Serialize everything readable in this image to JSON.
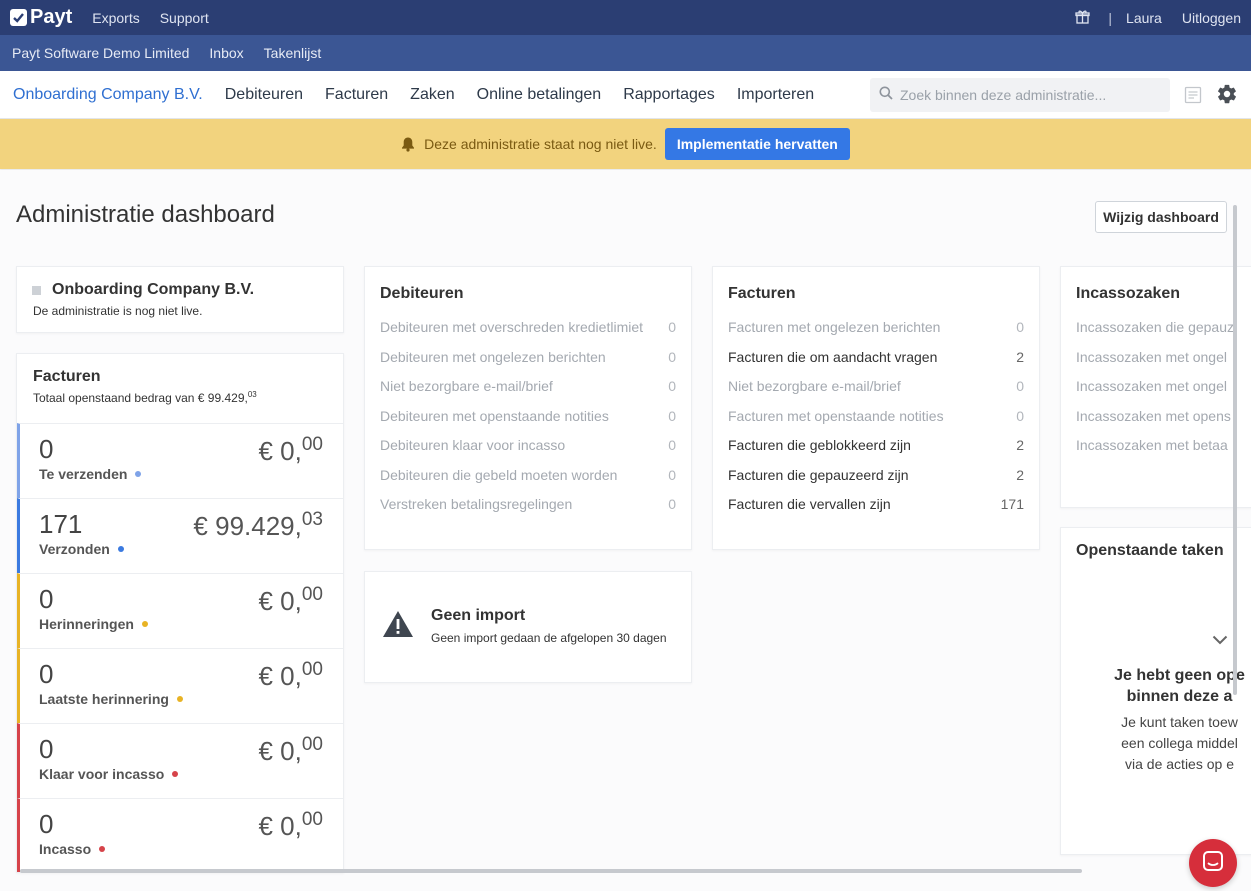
{
  "topbar": {
    "logo": "Payt",
    "links": [
      "Exports",
      "Support"
    ],
    "user": "Laura",
    "logout": "Uitloggen",
    "separator": "|"
  },
  "subbar": {
    "items": [
      "Payt Software Demo Limited",
      "Inbox",
      "Takenlijst"
    ]
  },
  "mainnav": {
    "company": "Onboarding Company B.V.",
    "items": [
      "Debiteuren",
      "Facturen",
      "Zaken",
      "Online betalingen",
      "Rapportages",
      "Importeren"
    ],
    "search_placeholder": "Zoek binnen deze administratie..."
  },
  "banner": {
    "text": "Deze administratie staat nog niet live.",
    "button": "Implementatie hervatten",
    "color": "#f2d37e"
  },
  "page": {
    "title": "Administratie dashboard",
    "edit_button": "Wijzig dashboard"
  },
  "company_card": {
    "name": "Onboarding Company B.V.",
    "status": "De administratie is nog niet live."
  },
  "facturen_card": {
    "title": "Facturen",
    "total_prefix": "Totaal openstaand bedrag van € 99.429,",
    "total_cents": "03",
    "rows": [
      {
        "count": "0",
        "euros": "€ 0,",
        "cents": "00",
        "label": "Te verzenden",
        "color": "#7fa3e8"
      },
      {
        "count": "171",
        "euros": "€ 99.429,",
        "cents": "03",
        "label": "Verzonden",
        "color": "#3b7ae0"
      },
      {
        "count": "0",
        "euros": "€ 0,",
        "cents": "00",
        "label": "Herinneringen",
        "color": "#e8b325"
      },
      {
        "count": "0",
        "euros": "€ 0,",
        "cents": "00",
        "label": "Laatste herinnering",
        "color": "#e8b325"
      },
      {
        "count": "0",
        "euros": "€ 0,",
        "cents": "00",
        "label": "Klaar voor incasso",
        "color": "#d6434a"
      },
      {
        "count": "0",
        "euros": "€ 0,",
        "cents": "00",
        "label": "Incasso",
        "color": "#d6434a"
      }
    ]
  },
  "debiteuren_card": {
    "title": "Debiteuren",
    "rows": [
      {
        "label": "Debiteuren met overschreden kredietlimiet",
        "value": "0"
      },
      {
        "label": "Debiteuren met ongelezen berichten",
        "value": "0"
      },
      {
        "label": "Niet bezorgbare e-mail/brief",
        "value": "0"
      },
      {
        "label": "Debiteuren met openstaande notities",
        "value": "0"
      },
      {
        "label": "Debiteuren klaar voor incasso",
        "value": "0"
      },
      {
        "label": "Debiteuren die gebeld moeten worden",
        "value": "0"
      },
      {
        "label": "Verstreken betalingsregelingen",
        "value": "0"
      }
    ]
  },
  "facturen_list_card": {
    "title": "Facturen",
    "rows": [
      {
        "label": "Facturen met ongelezen berichten",
        "value": "0"
      },
      {
        "label": "Facturen die om aandacht vragen",
        "value": "2"
      },
      {
        "label": "Niet bezorgbare e-mail/brief",
        "value": "0"
      },
      {
        "label": "Facturen met openstaande notities",
        "value": "0"
      },
      {
        "label": "Facturen die geblokkeerd zijn",
        "value": "2"
      },
      {
        "label": "Facturen die gepauzeerd zijn",
        "value": "2"
      },
      {
        "label": "Facturen die vervallen zijn",
        "value": "171"
      }
    ]
  },
  "incasso_card": {
    "title": "Incassozaken",
    "rows": [
      {
        "label": "Incassozaken die gepauz"
      },
      {
        "label": "Incassozaken met ongel"
      },
      {
        "label": "Incassozaken met ongel"
      },
      {
        "label": "Incassozaken met opens"
      },
      {
        "label": "Incassozaken met betaa"
      }
    ]
  },
  "import_card": {
    "title": "Geen import",
    "subtitle": "Geen import gedaan de afgelopen 30 dagen"
  },
  "tasks_card": {
    "title": "Openstaande taken",
    "msg_line1": "Je hebt geen ope",
    "msg_line2": "binnen deze a",
    "sub_line1": "Je kunt taken toew",
    "sub_line2": "een collega middel",
    "sub_line3": "via de acties op e"
  }
}
